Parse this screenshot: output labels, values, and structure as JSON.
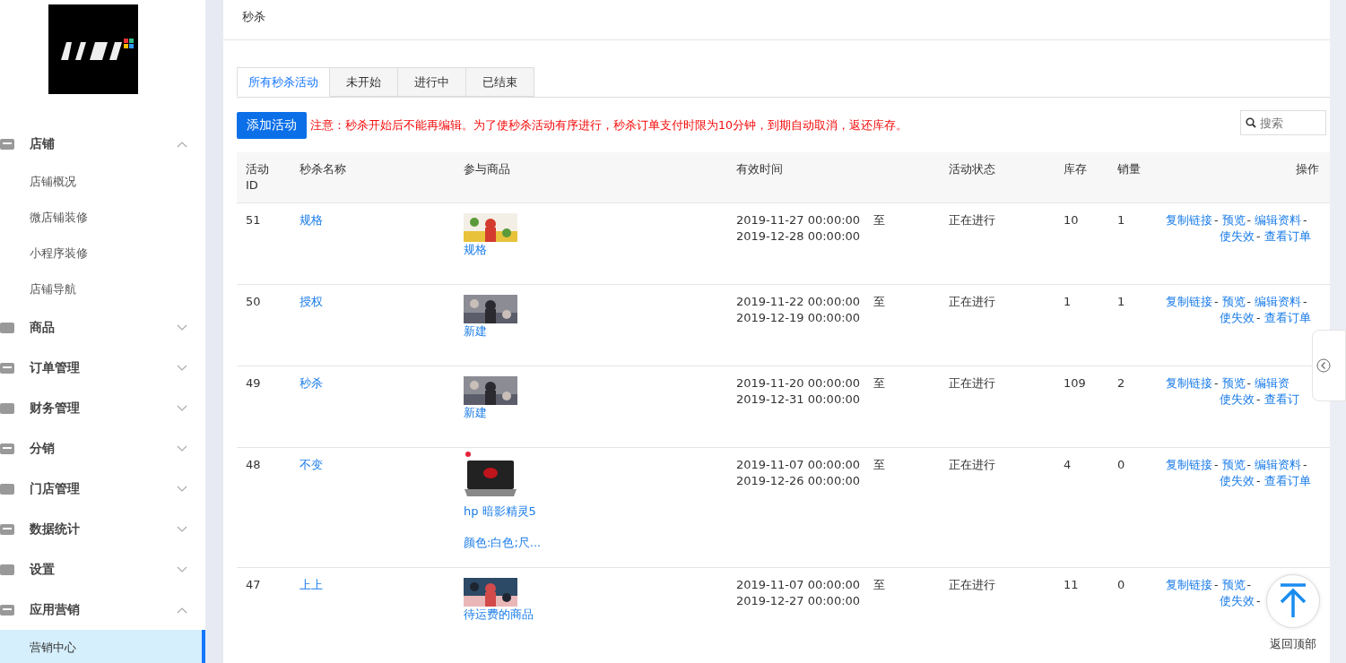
{
  "sidebar": {
    "items": [
      {
        "label": "店铺",
        "kind": "group",
        "expanded": true,
        "children": [
          {
            "label": "店铺概况",
            "selected": false
          },
          {
            "label": "微店铺装修",
            "selected": false
          },
          {
            "label": "小程序装修",
            "selected": false
          },
          {
            "label": "店铺导航",
            "selected": false
          }
        ]
      },
      {
        "label": "商品",
        "kind": "group",
        "expanded": false
      },
      {
        "label": "订单管理",
        "kind": "group",
        "expanded": false
      },
      {
        "label": "财务管理",
        "kind": "group",
        "expanded": false
      },
      {
        "label": "分销",
        "kind": "group",
        "expanded": false
      },
      {
        "label": "门店管理",
        "kind": "group",
        "expanded": false
      },
      {
        "label": "数据统计",
        "kind": "group",
        "expanded": false
      },
      {
        "label": "设置",
        "kind": "group",
        "expanded": false
      },
      {
        "label": "应用营销",
        "kind": "group",
        "expanded": true,
        "children": [
          {
            "label": "营销中心",
            "selected": true
          }
        ]
      }
    ]
  },
  "page_title": "秒杀",
  "tabs": [
    {
      "label": "所有秒杀活动",
      "selected": true
    },
    {
      "label": "未开始",
      "selected": false
    },
    {
      "label": "进行中",
      "selected": false
    },
    {
      "label": "已结束",
      "selected": false
    }
  ],
  "add_button": "添加活动",
  "notice": "注意：秒杀开始后不能再编辑。为了使秒杀活动有序进行，秒杀订单支付时限为10分钟，到期自动取消，返还库存。",
  "search": {
    "placeholder": "搜索"
  },
  "table": {
    "columns": [
      "活动ID",
      "秒杀名称",
      "参与商品",
      "有效时间",
      "活动状态",
      "库存",
      "销量",
      "操作"
    ],
    "rows": [
      {
        "id": "51",
        "name": "规格",
        "product": {
          "title": "规格"
        },
        "start": "2019-11-27 00:00:00",
        "to": "至",
        "end": "2019-12-28 00:00:00",
        "status": "正在进行",
        "stock": "10",
        "sales": "1",
        "actions": [
          [
            {
              "kind": "link",
              "text": "复制链接"
            },
            {
              "kind": "sep",
              "text": "-"
            },
            {
              "kind": "link",
              "text": "预览"
            },
            {
              "kind": "sep",
              "text": "-"
            },
            {
              "kind": "link",
              "text": "编辑资料"
            },
            {
              "kind": "sep",
              "text": "-"
            }
          ],
          [
            {
              "kind": "link",
              "text": "使失效"
            },
            {
              "kind": "sep",
              "text": "-"
            },
            {
              "kind": "link",
              "text": "查看订单"
            }
          ]
        ]
      },
      {
        "id": "50",
        "name": "授权",
        "product": {
          "title": "新建"
        },
        "start": "2019-11-22 00:00:00",
        "to": "至",
        "end": "2019-12-19 00:00:00",
        "status": "正在进行",
        "stock": "1",
        "sales": "1",
        "actions": [
          [
            {
              "kind": "link",
              "text": "复制链接"
            },
            {
              "kind": "sep",
              "text": "-"
            },
            {
              "kind": "link",
              "text": "预览"
            },
            {
              "kind": "sep",
              "text": "-"
            },
            {
              "kind": "link",
              "text": "编辑资料"
            },
            {
              "kind": "sep",
              "text": "-"
            }
          ],
          [
            {
              "kind": "link",
              "text": "使失效"
            },
            {
              "kind": "sep",
              "text": "-"
            },
            {
              "kind": "link",
              "text": "查看订单"
            }
          ]
        ]
      },
      {
        "id": "49",
        "name": "秒杀",
        "product": {
          "title": "新建"
        },
        "start": "2019-11-20 00:00:00",
        "to": "至",
        "end": "2019-12-31 00:00:00",
        "status": "正在进行",
        "stock": "109",
        "sales": "2",
        "actions": [
          [
            {
              "kind": "link",
              "text": "复制链接"
            },
            {
              "kind": "sep",
              "text": "-"
            },
            {
              "kind": "link",
              "text": "预览"
            },
            {
              "kind": "sep",
              "text": "-"
            },
            {
              "kind": "link",
              "text": "编辑资"
            }
          ],
          [
            {
              "kind": "link",
              "text": "使失效"
            },
            {
              "kind": "sep",
              "text": "-"
            },
            {
              "kind": "link",
              "text": "查看订"
            }
          ]
        ]
      },
      {
        "id": "48",
        "name": "不变",
        "product": {
          "title": "hp 暗影精灵5",
          "spec": "颜色:白色;尺..."
        },
        "start": "2019-11-07 00:00:00",
        "to": "至",
        "end": "2019-12-26 00:00:00",
        "status": "正在进行",
        "stock": "4",
        "sales": "0",
        "actions": [
          [
            {
              "kind": "link",
              "text": "复制链接"
            },
            {
              "kind": "sep",
              "text": "-"
            },
            {
              "kind": "link",
              "text": "预览"
            },
            {
              "kind": "sep",
              "text": "-"
            },
            {
              "kind": "link",
              "text": "编辑资料"
            },
            {
              "kind": "sep",
              "text": "-"
            }
          ],
          [
            {
              "kind": "link",
              "text": "使失效"
            },
            {
              "kind": "sep",
              "text": "-"
            },
            {
              "kind": "link",
              "text": "查看订单"
            }
          ]
        ]
      },
      {
        "id": "47",
        "name": "上上",
        "product": {
          "title": "待运费的商品"
        },
        "start": "2019-11-07 00:00:00",
        "to": "至",
        "end": "2019-12-27 00:00:00",
        "status": "正在进行",
        "stock": "11",
        "sales": "0",
        "actions": [
          [
            {
              "kind": "link",
              "text": "复制链接"
            },
            {
              "kind": "sep",
              "text": "-"
            },
            {
              "kind": "link",
              "text": "预览"
            },
            {
              "kind": "sep",
              "text": "-"
            }
          ],
          [
            {
              "kind": "link",
              "text": "使失效"
            },
            {
              "kind": "sep",
              "text": "-"
            }
          ]
        ]
      }
    ]
  },
  "back_to_top": "返回顶部"
}
